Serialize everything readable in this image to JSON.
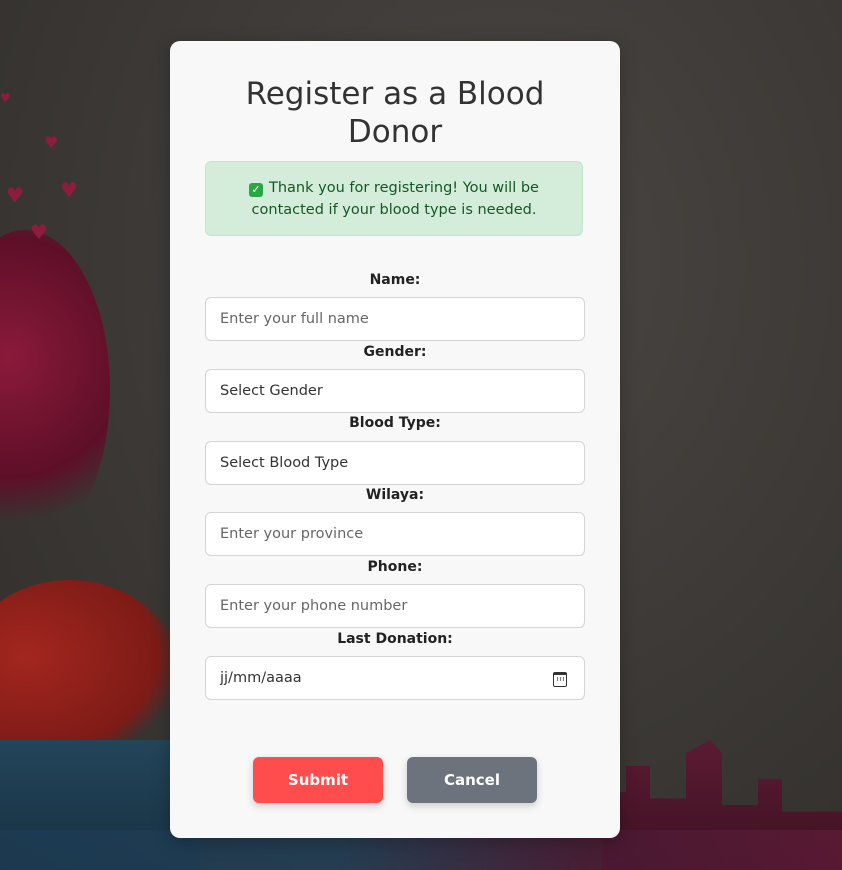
{
  "page": {
    "title": "Register as a Blood Donor"
  },
  "alert": {
    "message": "Thank you for registering! You will be contacted if your blood type is needed.",
    "icon": "check-square-icon",
    "color": "#155724",
    "background": "#d4edda"
  },
  "form": {
    "name": {
      "label": "Name:",
      "placeholder": "Enter your full name",
      "value": ""
    },
    "gender": {
      "label": "Gender:",
      "selected": "Select Gender"
    },
    "blood_type": {
      "label": "Blood Type:",
      "selected": "Select Blood Type"
    },
    "wilaya": {
      "label": "Wilaya:",
      "placeholder": "Enter your province",
      "value": ""
    },
    "phone": {
      "label": "Phone:",
      "placeholder": "Enter your phone number",
      "value": ""
    },
    "last_donation": {
      "label": "Last Donation:",
      "value": "jj/mm/aaaa",
      "icon": "calendar-icon"
    }
  },
  "buttons": {
    "submit": "Submit",
    "cancel": "Cancel"
  },
  "colors": {
    "submit": "#ff4c4c",
    "cancel": "#6c737d",
    "card": "#f8f8f8"
  }
}
